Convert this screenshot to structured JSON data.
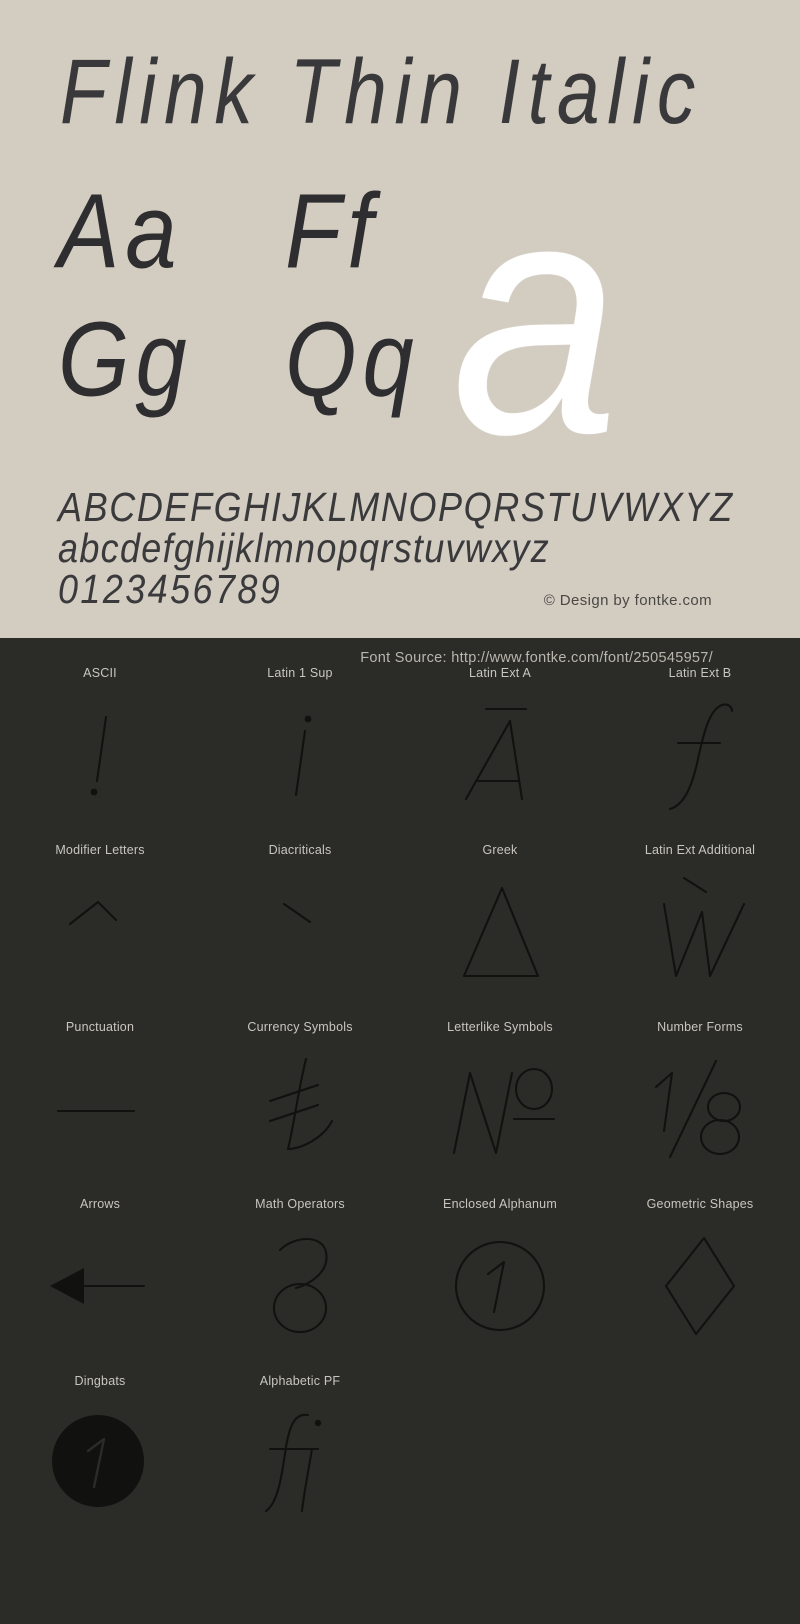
{
  "font": {
    "title": "Flink Thin Italic",
    "pairs": [
      "Aa",
      "Ff",
      "Gg",
      "Qq"
    ],
    "feature_glyph": "a",
    "uppercase": "ABCDEFGHIJKLMNOPQRSTUVWXYZ",
    "lowercase": "abcdefghijklmnopqrstuvwxyz",
    "digits": "0123456789"
  },
  "credit": "© Design by fontke.com",
  "source": "Font Source: http://www.fontke.com/font/250545957/",
  "colors": {
    "top_background": "#d3ccc1",
    "bottom_background": "#2b2b27",
    "title_text": "#39383a",
    "feature_glyph": "#ffffff",
    "label_text": "#c9c6bf",
    "glyph_dark": "#111110",
    "source_text": "#b9b6ae"
  },
  "blocks": [
    [
      {
        "label": "ASCII",
        "glyph": "!",
        "icon": "exclamation-glyph",
        "size": "sz-lg"
      },
      {
        "label": "Latin 1 Sup",
        "glyph": "¡",
        "icon": "inverted-exclamation-glyph",
        "size": "sz-lg"
      },
      {
        "label": "Latin Ext A",
        "glyph": "Ā",
        "icon": "a-macron-glyph",
        "size": "sz-xl"
      },
      {
        "label": "Latin Ext B",
        "glyph": "ƒ",
        "icon": "florin-glyph",
        "size": "sz-xl"
      }
    ],
    [
      {
        "label": "Modifier Letters",
        "glyph": "ˆ",
        "icon": "circumflex-glyph",
        "size": "sz-xl"
      },
      {
        "label": "Diacriticals",
        "glyph": "̀",
        "icon": "grave-accent-glyph",
        "size": "sz-xl"
      },
      {
        "label": "Greek",
        "glyph": "Δ",
        "icon": "delta-glyph",
        "size": "sz-xl"
      },
      {
        "label": "Latin Ext Additional",
        "glyph": "Ẁ",
        "icon": "w-grave-glyph",
        "size": "sz-xl"
      }
    ],
    [
      {
        "label": "Punctuation",
        "glyph": "—",
        "icon": "em-dash-glyph",
        "size": "sz-xl"
      },
      {
        "label": "Currency Symbols",
        "glyph": "₺",
        "icon": "lira-sign-glyph",
        "size": "sz-xl"
      },
      {
        "label": "Letterlike Symbols",
        "glyph": "№",
        "icon": "numero-glyph",
        "size": "sz-xl"
      },
      {
        "label": "Number Forms",
        "glyph": "⅛",
        "icon": "one-eighth-glyph",
        "size": "sz-xl"
      }
    ],
    [
      {
        "label": "Arrows",
        "glyph": "←",
        "icon": "left-arrow-glyph",
        "size": "sz-xl"
      },
      {
        "label": "Math Operators",
        "glyph": "∂",
        "icon": "partial-derivative-glyph",
        "size": "sz-xl"
      },
      {
        "label": "Enclosed Alphanum",
        "glyph": "①",
        "icon": "circled-one-glyph",
        "size": "sz-xl"
      },
      {
        "label": "Geometric Shapes",
        "glyph": "◊",
        "icon": "lozenge-glyph",
        "size": "sz-xl"
      }
    ],
    [
      {
        "label": "Dingbats",
        "glyph": "➀",
        "icon": "filled-circled-one-glyph",
        "size": "sz-xl"
      },
      {
        "label": "Alphabetic PF",
        "glyph": "ﬁ",
        "icon": "fi-ligature-glyph",
        "size": "sz-xl"
      },
      {
        "label": "",
        "glyph": "",
        "icon": "empty-cell",
        "size": "sz-xl"
      },
      {
        "label": "",
        "glyph": "",
        "icon": "empty-cell",
        "size": "sz-xl"
      }
    ]
  ]
}
